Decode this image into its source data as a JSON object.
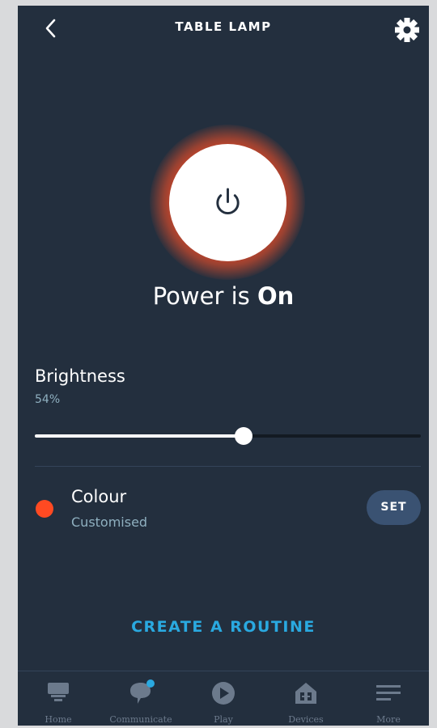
{
  "header": {
    "title": "TABLE LAMP"
  },
  "power": {
    "status_prefix": "Power is",
    "status_value": "On"
  },
  "brightness": {
    "label": "Brightness",
    "value_text": "54%",
    "level": 0.54
  },
  "colour": {
    "label": "Colour",
    "value": "Customised",
    "swatch": "#ff4a22",
    "set_label": "SET"
  },
  "routine": {
    "label": "CREATE A ROUTINE"
  },
  "nav": {
    "home": "Home",
    "communicate": "Communicate",
    "play": "Play",
    "devices": "Devices",
    "more": "More"
  },
  "colors": {
    "background": "#232f3e",
    "accent": "#2aa9e0",
    "glow": "#ff4a22"
  },
  "icons": [
    "back-icon",
    "gear-icon",
    "power-icon",
    "home-icon",
    "communicate-icon",
    "play-icon",
    "devices-icon",
    "more-icon"
  ]
}
